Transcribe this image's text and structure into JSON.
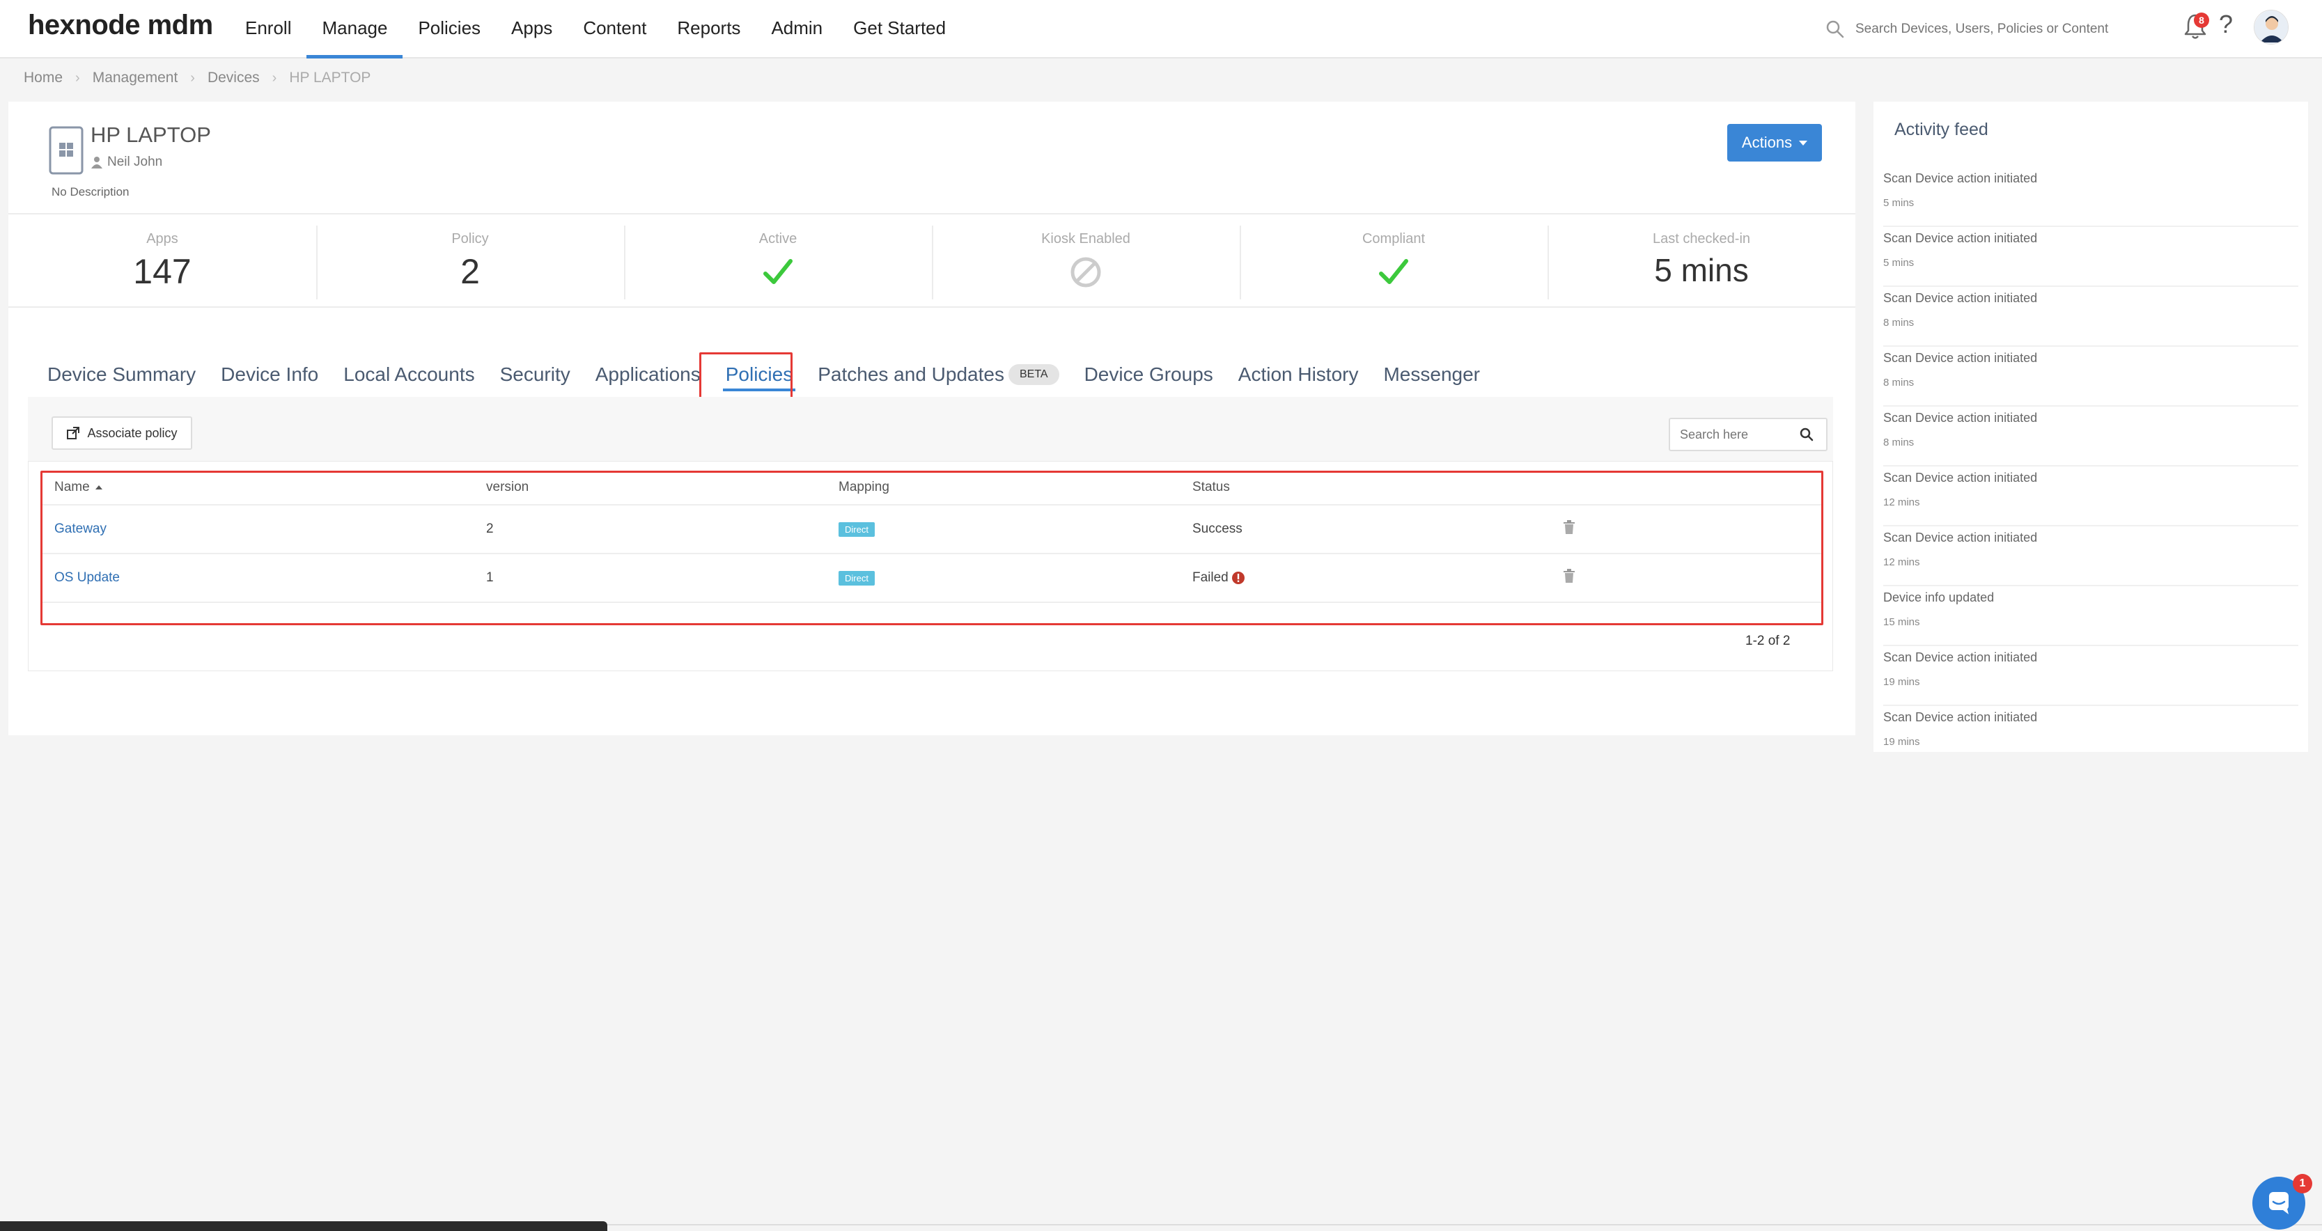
{
  "app": {
    "logo": "hexnode mdm"
  },
  "nav": {
    "items": [
      {
        "label": "Enroll"
      },
      {
        "label": "Manage"
      },
      {
        "label": "Policies"
      },
      {
        "label": "Apps"
      },
      {
        "label": "Content"
      },
      {
        "label": "Reports"
      },
      {
        "label": "Admin"
      },
      {
        "label": "Get Started"
      }
    ],
    "active": "Manage",
    "search_placeholder": "Search Devices, Users, Policies or Content",
    "notification_count": "8"
  },
  "breadcrumb": [
    "Home",
    "Management",
    "Devices",
    "HP LAPTOP"
  ],
  "device": {
    "name": "HP LAPTOP",
    "user": "Neil John",
    "description": "No Description",
    "actions_label": "Actions"
  },
  "stats": [
    {
      "label": "Apps",
      "value": "147"
    },
    {
      "label": "Policy",
      "value": "2"
    },
    {
      "label": "Active",
      "icon": "check-icon"
    },
    {
      "label": "Kiosk Enabled",
      "icon": "disabled-icon"
    },
    {
      "label": "Compliant",
      "icon": "check-icon"
    },
    {
      "label": "Last checked-in",
      "value": "5 mins"
    }
  ],
  "tabs": [
    {
      "label": "Device Summary"
    },
    {
      "label": "Device Info"
    },
    {
      "label": "Local Accounts"
    },
    {
      "label": "Security"
    },
    {
      "label": "Applications"
    },
    {
      "label": "Policies"
    },
    {
      "label": "Patches and Updates",
      "badge": "BETA"
    },
    {
      "label": "Device Groups"
    },
    {
      "label": "Action History"
    },
    {
      "label": "Messenger"
    }
  ],
  "active_tab": "Policies",
  "policies": {
    "associate_label": "Associate policy",
    "search_placeholder": "Search here",
    "columns": {
      "name": "Name",
      "version": "version",
      "mapping": "Mapping",
      "status": "Status"
    },
    "rows": [
      {
        "name": "Gateway",
        "version": "2",
        "mapping": "Direct",
        "status": "Success"
      },
      {
        "name": "OS Update",
        "version": "1",
        "mapping": "Direct",
        "status": "Failed"
      }
    ],
    "pagination": "1-2 of 2"
  },
  "activity_feed": {
    "title": "Activity feed",
    "items": [
      {
        "text": "Scan Device action initiated",
        "time": "5 mins"
      },
      {
        "text": "Scan Device action initiated",
        "time": "5 mins"
      },
      {
        "text": "Scan Device action initiated",
        "time": "8 mins"
      },
      {
        "text": "Scan Device action initiated",
        "time": "8 mins"
      },
      {
        "text": "Scan Device action initiated",
        "time": "8 mins"
      },
      {
        "text": "Scan Device action initiated",
        "time": "12 mins"
      },
      {
        "text": "Scan Device action initiated",
        "time": "12 mins"
      },
      {
        "text": "Device info updated",
        "time": "15 mins"
      },
      {
        "text": "Scan Device action initiated",
        "time": "19 mins"
      },
      {
        "text": "Scan Device action initiated",
        "time": "19 mins"
      }
    ]
  },
  "chat": {
    "badge": "1"
  },
  "colors": {
    "accent": "#3a86d6",
    "highlight": "#e53935",
    "success": "#3cc93c",
    "mapping_badge": "#5bc0de"
  }
}
